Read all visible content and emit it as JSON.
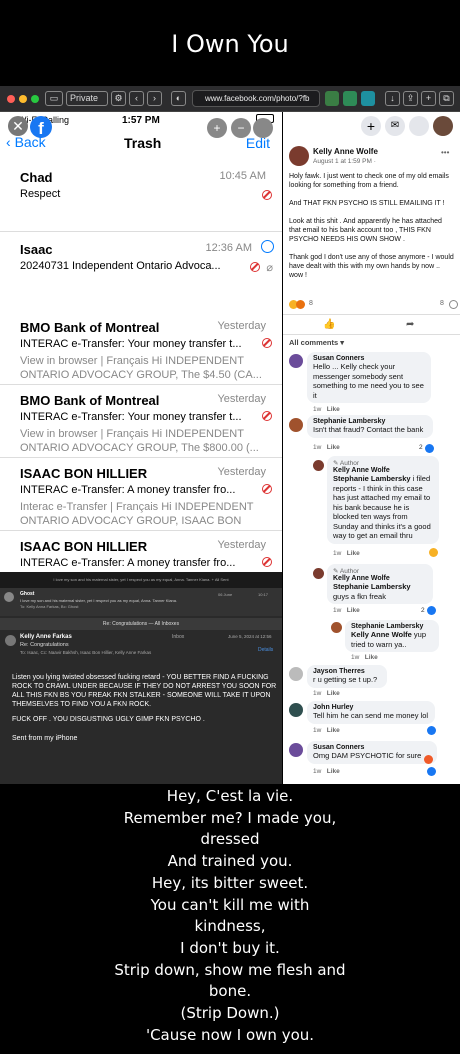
{
  "title": "I Own You",
  "browser": {
    "private_label": "Private",
    "url": "www.facebook.com/photo/?fb"
  },
  "mail": {
    "status_left": "Wi-Fi Calling",
    "status_time": "1:57 PM",
    "back_label": "Back",
    "folder_title": "Trash",
    "edit_label": "Edit",
    "rows": [
      {
        "sender": "Chad",
        "time": "10:45 AM",
        "subject": "Respect",
        "preview": ""
      },
      {
        "sender": "Isaac",
        "time": "12:36 AM",
        "subject": "20240731 Independent Ontario Advoca...",
        "preview": ""
      },
      {
        "sender": "BMO Bank of Montreal",
        "time": "Yesterday",
        "subject": "INTERAC e-Transfer: Your money transfer t...",
        "preview": "View in browser | Français Hi INDEPENDENT ONTARIO ADVOCACY GROUP, The $4.50 (CA..."
      },
      {
        "sender": "BMO Bank of Montreal",
        "time": "Yesterday",
        "subject": "INTERAC e-Transfer: Your money transfer t...",
        "preview": "View in browser | Français Hi INDEPENDENT ONTARIO ADVOCACY GROUP, The $800.00 (..."
      },
      {
        "sender": "ISAAC BON HILLIER",
        "time": "Yesterday",
        "subject": "INTERAC e-Transfer: A money transfer fro...",
        "preview": "Interac e-Transfer | Français Hi INDEPENDENT ONTARIO ADVOCACY GROUP, ISAAC BON HIL..."
      },
      {
        "sender": "ISAAC BON HILLIER",
        "time": "Yesterday",
        "subject": "INTERAC e-Transfer: A money transfer fro...",
        "preview": ""
      }
    ]
  },
  "email": {
    "top_banner": "I love my son and his maternal sister, yet I respect you as my equal, Anna. Tanner Kiana. + All Sent",
    "ghost_sender": "Ghost",
    "ghost_line": "I love my son and his maternal sister, yet I respect you as my equal, Anna. Tanner Kiana.",
    "ghost_to": "To:  Kelly Anna Farkas,  Bc:  Ghost",
    "ghost_date": "06 June",
    "ghost_time": "10:17",
    "thread_bar": "Re: Congratulations — All Inboxes",
    "sender": "Kelly Anne Farkas",
    "mailbox": "Inbox",
    "date": "June 5, 2024 at 12:56",
    "subject": "Re: Congratulations",
    "to_line": "To:  Isaac,  Cc:  Naavir Bakhsh,   Isaac Bon Hillier,   Kelly Anne Farkas",
    "details": "Details",
    "body1": "Listen you lying twisted obsessed fucking retard - YOU BETTER FIND A FUCKING ROCK TO CRAWL UNDER BECAUSE IF THEY DO NOT ARREST YOU SOON FOR ALL THIS FKN BS YOU FREAK FKN STALKER - SOMEONE WILL TAKE IT UPON THEMSELVES TO FIND YOU A FKN ROCK.",
    "body2": "FUCK OFF .  YOU DISGUSTING UGLY GIMP FKN PSYCHO .",
    "signature": "Sent from my iPhone"
  },
  "fb": {
    "author": "Kelly Anne Wolfe",
    "post_time": "August 1 at 1:59 PM · ",
    "post_p1": "Holy fawk. I just went to check one of my old emails looking for something from a friend.",
    "post_p2": "And THAT FKN PSYCHO IS STILL EMAILING IT !",
    "post_p3": "Look at this shit . And apparently he has attached that email to his bank account too , THIS FKN PSYCHO NEEDS HIS OWN SHOW .",
    "post_p4": "Thank god I don't use any of those anymore - I would have dealt with this with my own hands by now .. wow !",
    "reactions": "8",
    "comment_count": "8",
    "all_comments": "All comments",
    "like": "Like",
    "reply": "1w",
    "author_badge": "Author",
    "comments": [
      {
        "name": "Susan Conners",
        "text": "Hello ... Kelly check your messenger somebody sent something to me need you to see it",
        "time": "1w",
        "count": ""
      },
      {
        "name": "Stephanie Lambersky",
        "text": "Isn't that fraud? Contact the bank",
        "time": "1w",
        "count": "2"
      },
      {
        "name": "Kelly Anne Wolfe",
        "mention": "Stephanie Lambersky",
        "text": " i filed reports - I think in this case has just attached my email to his bank because he is blocked ten ways from Sunday and thinks it's a good way to get an email thru",
        "time": "1w",
        "count": ""
      },
      {
        "name": "Kelly Anne Wolfe",
        "mention": "Stephanie Lambersky",
        "text": " guys a fkn freak",
        "time": "1w",
        "count": "2"
      },
      {
        "name": "Stephanie Lambersky",
        "mention": "Kelly Anne Wolfe",
        "text": " yup tried to warn ya..",
        "time": "1w",
        "count": ""
      },
      {
        "name": "Jayson Therres",
        "text": "r u getting se t up.?",
        "time": "1w",
        "count": ""
      },
      {
        "name": "John Hurley",
        "text": "Tell him he can send me money lol",
        "time": "1w",
        "count": ""
      },
      {
        "name": "Susan Conners",
        "text": "Omg DAM PSYCHOTIC for sure",
        "time": "1w",
        "count": ""
      }
    ]
  },
  "lyrics": [
    "Hey, C'est la vie.",
    "Remember me? I made you,",
    "dressed",
    "And trained you.",
    "Hey, its bitter sweet.",
    "You can't kill me with",
    "kindness,",
    "I don't buy it.",
    "Strip down, show me flesh and",
    "bone.",
    "(Strip Down.)",
    "'Cause now I own you."
  ]
}
